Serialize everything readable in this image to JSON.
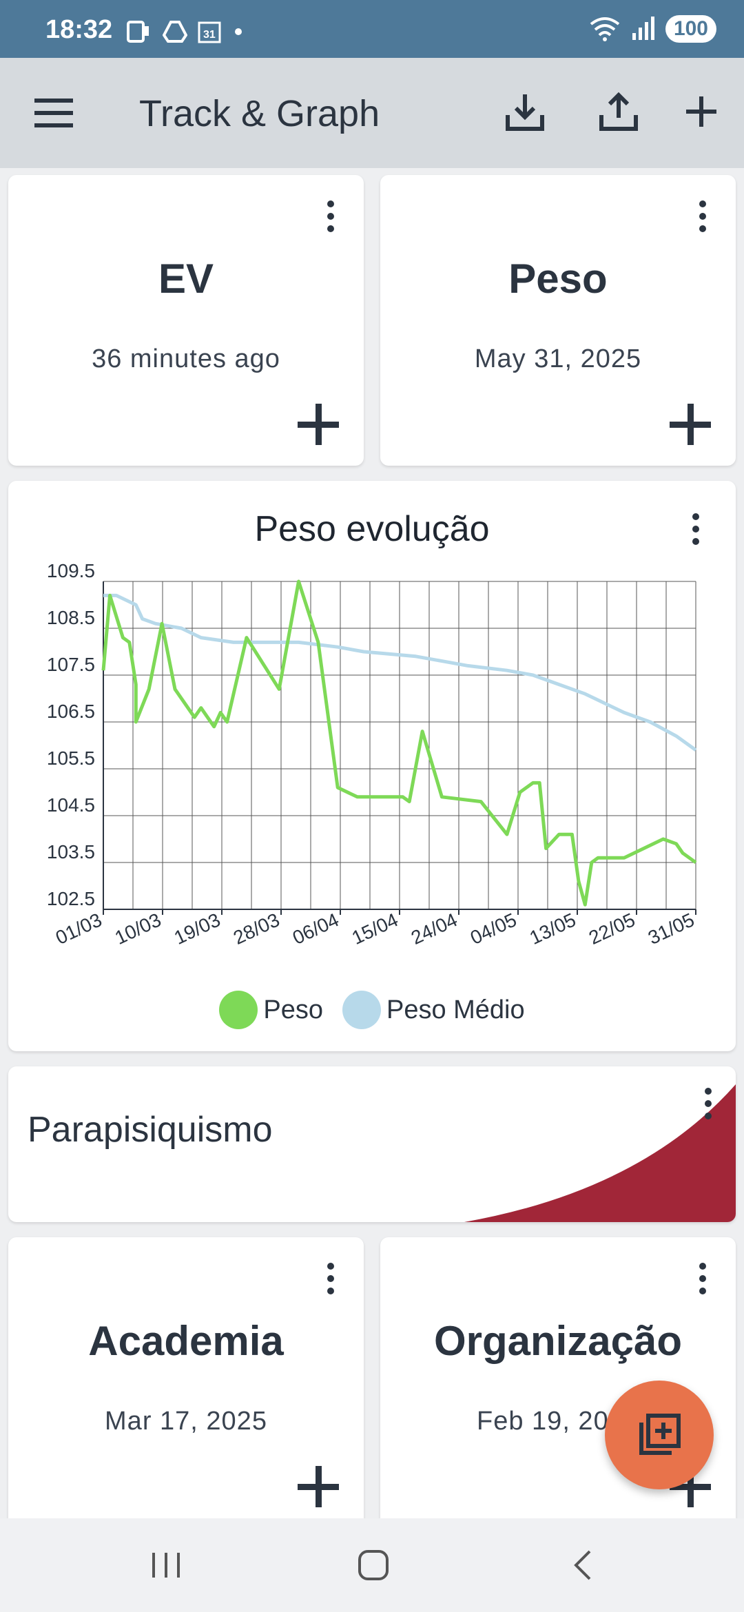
{
  "status_bar": {
    "time": "18:32",
    "battery": "100"
  },
  "app_bar": {
    "title": "Track & Graph",
    "icons": [
      "menu-icon",
      "download-icon",
      "upload-icon",
      "add-icon"
    ]
  },
  "trackers_top": [
    {
      "name": "EV",
      "subtitle": "36 minutes ago"
    },
    {
      "name": "Peso",
      "subtitle": "May 31, 2025"
    }
  ],
  "graph": {
    "title": "Peso evolução",
    "legend": [
      {
        "label": "Peso",
        "color": "#7ed957"
      },
      {
        "label": "Peso Médio",
        "color": "#b7d9ea"
      }
    ]
  },
  "chart_data": {
    "type": "line",
    "title": "Peso evolução",
    "ylim": [
      102.5,
      109.5
    ],
    "yticks": [
      "109.5",
      "108.5",
      "107.5",
      "106.5",
      "105.5",
      "104.5",
      "103.5",
      "102.5"
    ],
    "xticks": [
      "01/03",
      "10/03",
      "19/03",
      "28/03",
      "06/04",
      "15/04",
      "24/04",
      "04/05",
      "13/05",
      "22/05",
      "31/05"
    ],
    "x_range_days": [
      0,
      91
    ],
    "series": [
      {
        "name": "Peso",
        "color": "#7ed957",
        "points": [
          [
            0,
            107.6
          ],
          [
            1,
            109.2
          ],
          [
            3,
            108.3
          ],
          [
            4,
            108.2
          ],
          [
            5,
            107.3
          ],
          [
            5,
            106.5
          ],
          [
            7,
            107.2
          ],
          [
            9,
            108.6
          ],
          [
            11,
            107.2
          ],
          [
            14,
            106.6
          ],
          [
            15,
            106.8
          ],
          [
            17,
            106.4
          ],
          [
            18,
            106.7
          ],
          [
            19,
            106.5
          ],
          [
            22,
            108.3
          ],
          [
            27,
            107.2
          ],
          [
            30,
            109.5
          ],
          [
            33,
            108.2
          ],
          [
            36,
            105.1
          ],
          [
            39,
            104.9
          ],
          [
            46,
            104.9
          ],
          [
            47,
            104.8
          ],
          [
            49,
            106.3
          ],
          [
            52,
            104.9
          ],
          [
            58,
            104.8
          ],
          [
            62,
            104.1
          ],
          [
            64,
            105.0
          ],
          [
            66,
            105.2
          ],
          [
            67,
            105.2
          ],
          [
            68,
            103.8
          ],
          [
            70,
            104.1
          ],
          [
            72,
            104.1
          ],
          [
            73,
            103.1
          ],
          [
            74,
            102.6
          ],
          [
            75,
            103.5
          ],
          [
            76,
            103.6
          ],
          [
            80,
            103.6
          ],
          [
            86,
            104.0
          ],
          [
            88,
            103.9
          ],
          [
            89,
            103.7
          ],
          [
            91,
            103.5
          ]
        ]
      },
      {
        "name": "Peso Médio",
        "color": "#b7d9ea",
        "points": [
          [
            0,
            109.2
          ],
          [
            2,
            109.2
          ],
          [
            5,
            109.0
          ],
          [
            6,
            108.7
          ],
          [
            8,
            108.6
          ],
          [
            12,
            108.5
          ],
          [
            15,
            108.3
          ],
          [
            20,
            108.2
          ],
          [
            30,
            108.2
          ],
          [
            36,
            108.1
          ],
          [
            40,
            108.0
          ],
          [
            48,
            107.9
          ],
          [
            52,
            107.8
          ],
          [
            56,
            107.7
          ],
          [
            62,
            107.6
          ],
          [
            66,
            107.5
          ],
          [
            70,
            107.3
          ],
          [
            74,
            107.1
          ],
          [
            80,
            106.7
          ],
          [
            84,
            106.5
          ],
          [
            88,
            106.2
          ],
          [
            91,
            105.9
          ]
        ]
      }
    ]
  },
  "group": {
    "name": "Parapisiquismo"
  },
  "trackers_bottom": [
    {
      "name": "Academia",
      "subtitle": "Mar 17, 2025"
    },
    {
      "name": "Organização",
      "subtitle": "Feb 19, 2025"
    }
  ]
}
